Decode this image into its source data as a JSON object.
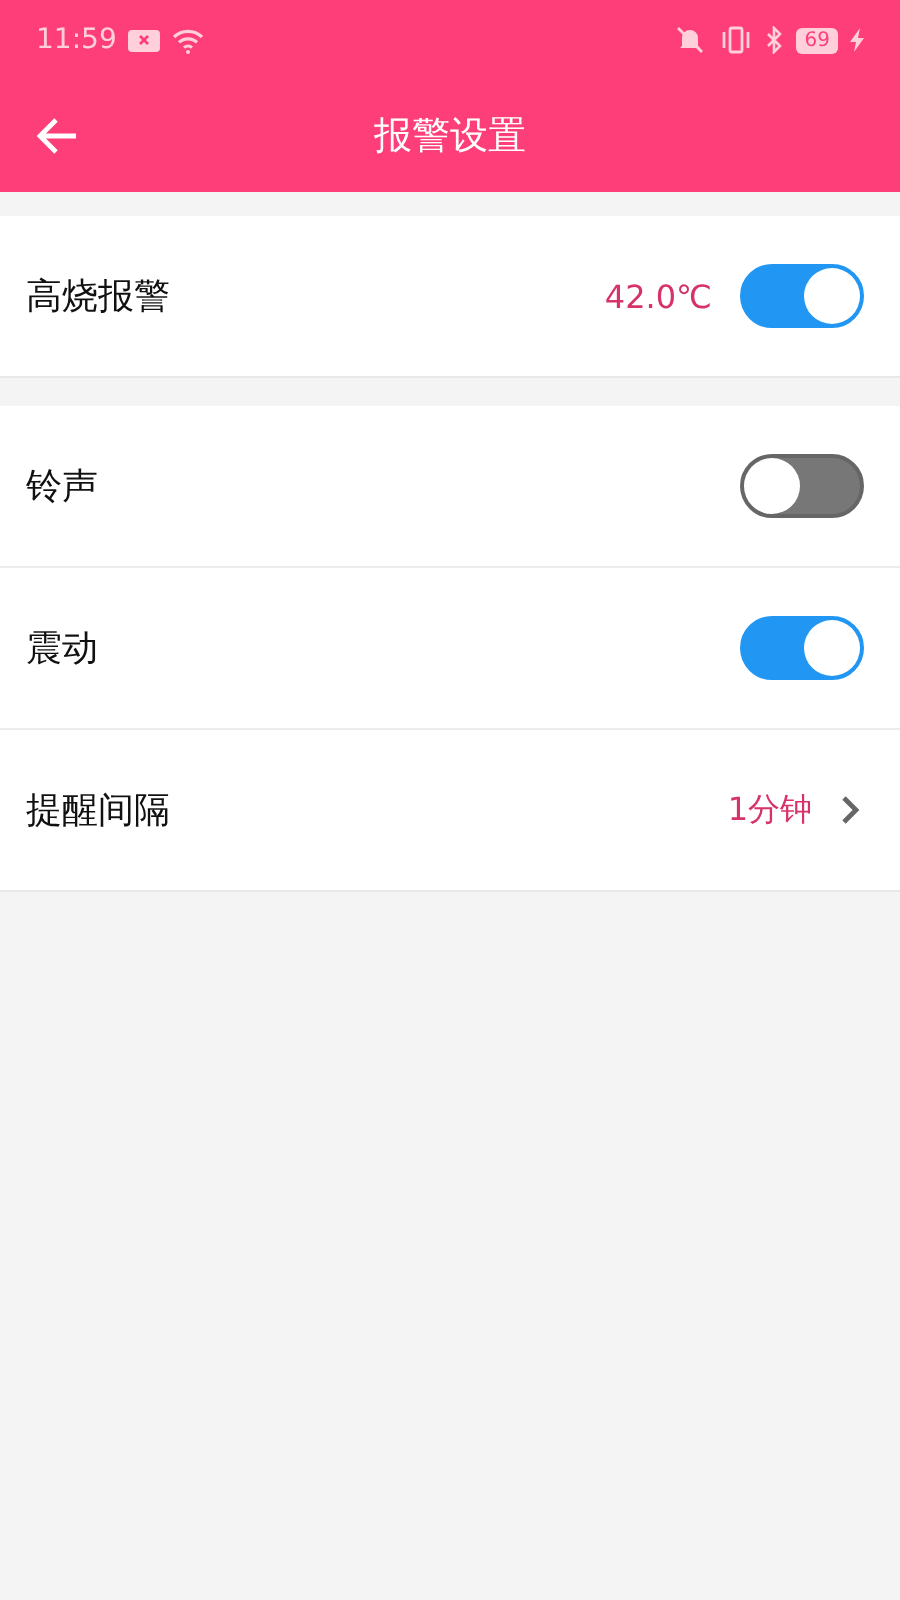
{
  "status_bar": {
    "time": "11:59",
    "battery": "69"
  },
  "header": {
    "title": "报警设置"
  },
  "groups": [
    {
      "rows": [
        {
          "kind": "switch",
          "label": "高烧报警",
          "value": "42.0℃",
          "on": true
        }
      ]
    },
    {
      "rows": [
        {
          "kind": "switch",
          "label": "铃声",
          "on": false
        },
        {
          "kind": "switch",
          "label": "震动",
          "on": true
        },
        {
          "kind": "link",
          "label": "提醒间隔",
          "value": "1分钟"
        }
      ]
    }
  ]
}
